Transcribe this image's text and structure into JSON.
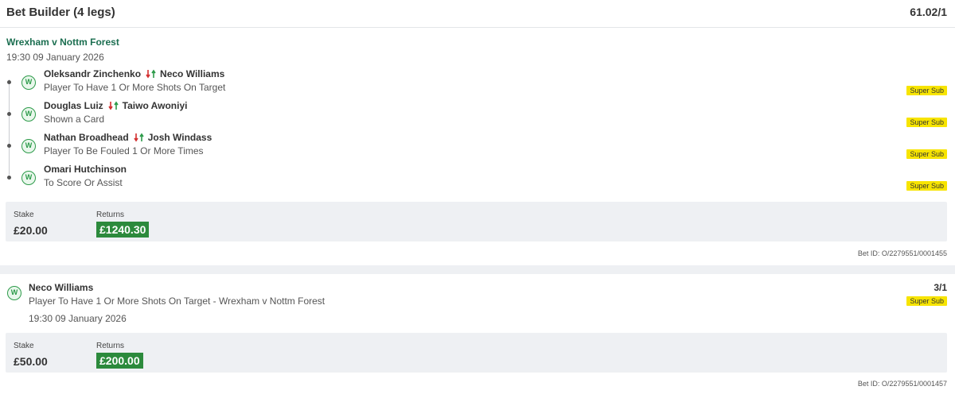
{
  "bet_builder": {
    "title": "Bet Builder (4 legs)",
    "odds": "61.02/1",
    "match": "Wrexham v Nottm Forest",
    "time": "19:30 09 January 2026",
    "legs": [
      {
        "badge": "W",
        "player": "Oleksandr Zinchenko",
        "sub": "Neco Williams",
        "market": "Player To Have 1 Or More Shots On Target",
        "tag": "Super Sub"
      },
      {
        "badge": "W",
        "player": "Douglas Luiz",
        "sub": "Taiwo Awoniyi",
        "market": "Shown a Card",
        "tag": "Super Sub"
      },
      {
        "badge": "W",
        "player": "Nathan Broadhead",
        "sub": "Josh Windass",
        "market": "Player To Be Fouled 1 Or More Times",
        "tag": "Super Sub"
      },
      {
        "badge": "W",
        "player": "Omari Hutchinson",
        "sub": "",
        "market": "To Score Or Assist",
        "tag": "Super Sub"
      }
    ],
    "stake_label": "Stake",
    "stake": "£20.00",
    "returns_label": "Returns",
    "returns": "£1240.30",
    "bet_id": "Bet ID: O/2279551/0001455"
  },
  "single_bet": {
    "badge": "W",
    "player": "Neco Williams",
    "market": "Player To Have 1 Or More Shots On Target - Wrexham v Nottm Forest",
    "odds": "3/1",
    "tag": "Super Sub",
    "time": "19:30 09 January 2026",
    "stake_label": "Stake",
    "stake": "£50.00",
    "returns_label": "Returns",
    "returns": "£200.00",
    "bet_id": "Bet ID: O/2279551/0001457"
  },
  "colors": {
    "win_green": "#2d9b4a",
    "returns_bg": "#2c8a3c",
    "super_sub_bg": "#f7e400",
    "match_link": "#1b6e50",
    "swap_red": "#d32f2f",
    "swap_green": "#2d9b4a"
  },
  "icons": {
    "result": "win-badge-icon",
    "substitution": "substitution-arrows-icon"
  }
}
